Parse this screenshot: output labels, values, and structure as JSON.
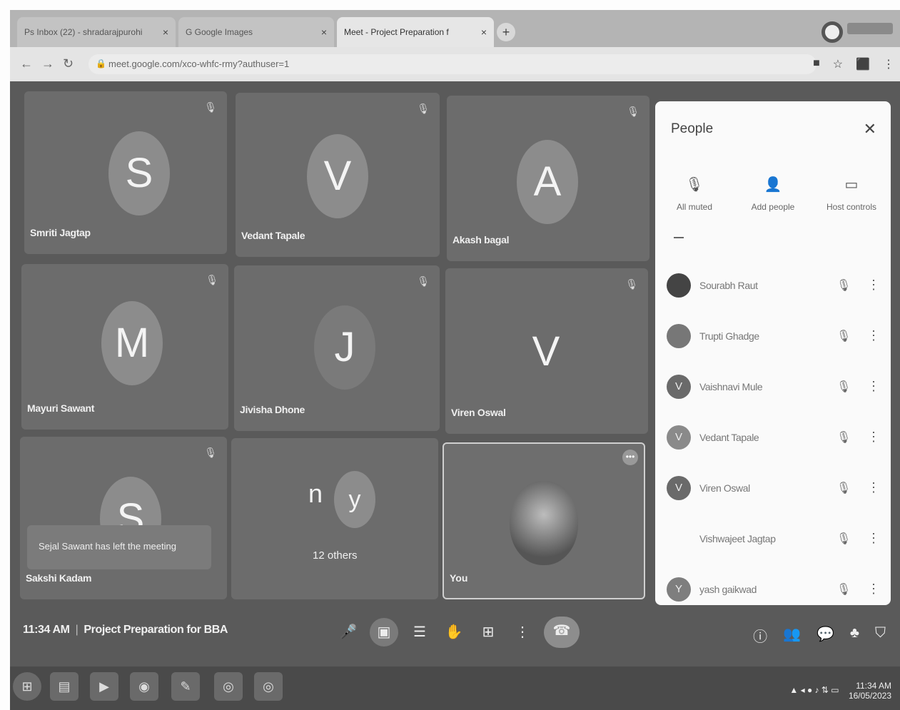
{
  "browser": {
    "tabs": [
      {
        "label": "Ps  Inbox (22) - shradarajpurohi",
        "active": false
      },
      {
        "label": "G  Google Images",
        "active": false
      },
      {
        "label": "Meet - Project Preparation f",
        "active": true
      }
    ],
    "url": "meet.google.com/xco-whfc-rmy?authuser=1"
  },
  "tiles": [
    {
      "initial": "S",
      "name": "Smriti Jagtap"
    },
    {
      "initial": "V",
      "name": "Vedant Tapale"
    },
    {
      "initial": "A",
      "name": "Akash bagal"
    },
    {
      "initial": "M",
      "name": "Mayuri Sawant"
    },
    {
      "initial": "J",
      "name": "Jivisha Dhone"
    },
    {
      "initial": "V",
      "name": "Viren Oswal"
    },
    {
      "initial": "S",
      "name": "Sakshi Kadam"
    }
  ],
  "toast": "Sejal Sawant has left the meeting",
  "others": {
    "initial1": "n",
    "initial2": "y",
    "label": "12 others"
  },
  "self": {
    "label": "You"
  },
  "people_panel": {
    "title": "People",
    "actions": [
      {
        "icon": "mic-off-icon",
        "label": "All muted"
      },
      {
        "icon": "add-person-icon",
        "label": "Add people"
      },
      {
        "icon": "host-controls-icon",
        "label": "Host controls"
      }
    ],
    "participants": [
      {
        "initial": "",
        "name": "Sourabh Raut"
      },
      {
        "initial": "",
        "name": "Trupti Ghadge"
      },
      {
        "initial": "V",
        "name": "Vaishnavi Mule"
      },
      {
        "initial": "V",
        "name": "Vedant Tapale"
      },
      {
        "initial": "V",
        "name": "Viren Oswal"
      },
      {
        "initial": "",
        "name": "Vishwajeet Jagtap"
      },
      {
        "initial": "Y",
        "name": "yash gaikwad"
      }
    ]
  },
  "meeting": {
    "time": "11:34 AM",
    "title": "Project Preparation for BBA"
  },
  "taskbar": {
    "time": "11:34 AM",
    "date": "16/05/2023"
  }
}
